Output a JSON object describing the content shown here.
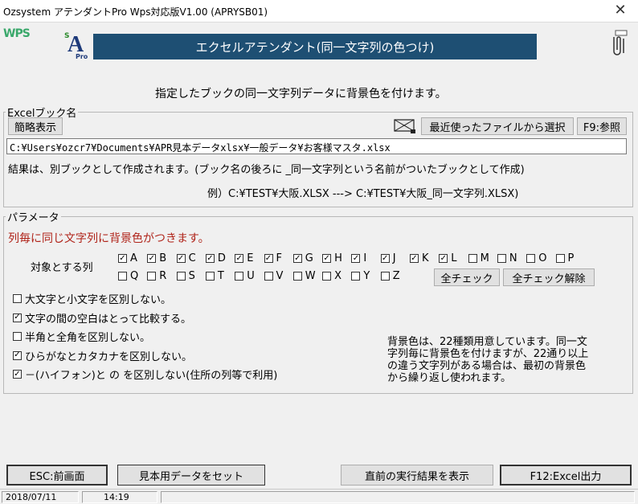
{
  "window": {
    "title": "Ozsystem アテンダントPro Wps対応版V1.00 (APRYSB01)",
    "close_glyph": "✕"
  },
  "logos": {
    "wps": "WPS",
    "sa_s": "S",
    "sa_a": "A",
    "sa_pro": "Pro"
  },
  "banner": {
    "text": "エクセルアテンダント(同一文字列の色つけ)"
  },
  "subtitle": "指定したブックの同一文字列データに背景色を付けます。",
  "excel_book": {
    "legend": "Excelブック名",
    "brief_button": "簡略表示",
    "recent_button": "最近使ったファイルから選択",
    "browse_button": "F9:参照",
    "path": "C:¥Users¥ozcr7¥Documents¥APR見本データxlsx¥一般データ¥お客様マスタ.xlsx",
    "note": "結果は、別ブックとして作成されます。(ブック名の後ろに _同一文字列という名前がついたブックとして作成)",
    "example": "例）C:¥TEST¥大阪.XLSX ---> C:¥TEST¥大阪_同一文字列.XLSX)"
  },
  "params": {
    "legend": "パラメータ",
    "headline": "列毎に同じ文字列に背景色がつきます。",
    "target_label": "対象とする列",
    "columns_row1": [
      {
        "label": "A",
        "checked": true
      },
      {
        "label": "B",
        "checked": true
      },
      {
        "label": "C",
        "checked": true
      },
      {
        "label": "D",
        "checked": true
      },
      {
        "label": "E",
        "checked": true
      },
      {
        "label": "F",
        "checked": true
      },
      {
        "label": "G",
        "checked": true
      },
      {
        "label": "H",
        "checked": true
      },
      {
        "label": "I",
        "checked": true
      },
      {
        "label": "J",
        "checked": true
      },
      {
        "label": "K",
        "checked": true
      },
      {
        "label": "L",
        "checked": true
      },
      {
        "label": "M",
        "checked": false
      },
      {
        "label": "N",
        "checked": false
      },
      {
        "label": "O",
        "checked": false
      },
      {
        "label": "P",
        "checked": false
      }
    ],
    "columns_row2": [
      {
        "label": "Q",
        "checked": false
      },
      {
        "label": "R",
        "checked": false
      },
      {
        "label": "S",
        "checked": false
      },
      {
        "label": "T",
        "checked": false
      },
      {
        "label": "U",
        "checked": false
      },
      {
        "label": "V",
        "checked": false
      },
      {
        "label": "W",
        "checked": false
      },
      {
        "label": "X",
        "checked": false
      },
      {
        "label": "Y",
        "checked": false
      },
      {
        "label": "Z",
        "checked": false
      }
    ],
    "check_all_button": "全チェック",
    "uncheck_all_button": "全チェック解除",
    "options": [
      {
        "label": "大文字と小文字を区別しない。",
        "checked": false
      },
      {
        "label": "文字の間の空白はとって比較する。",
        "checked": true
      },
      {
        "label": "半角と全角を区別しない。",
        "checked": false
      },
      {
        "label": "ひらがなとカタカナを区別しない。",
        "checked": true
      },
      {
        "label": "－(ハイフォン)と の を区別しない(住所の列等で利用)",
        "checked": true
      }
    ],
    "info": [
      "背景色は、22種類用意しています。同一文",
      "字列毎に背景色を付けますが、22通り以上",
      "の違う文字列がある場合は、最初の背景色",
      "から繰り返し使われます。"
    ]
  },
  "footer": {
    "esc_button": "ESC:前画面",
    "sample_button": "見本用データをセット",
    "prev_result_button": "直前の実行結果を表示",
    "output_button": "F12:Excel出力"
  },
  "status": {
    "date": "2018/07/11",
    "time": "14:19"
  },
  "colors": {
    "banner": "#1e4f73",
    "headline": "#b0241a",
    "wps": "#3aa86b"
  },
  "icons": [
    "close-icon",
    "paperclip-icon",
    "window-icon"
  ]
}
